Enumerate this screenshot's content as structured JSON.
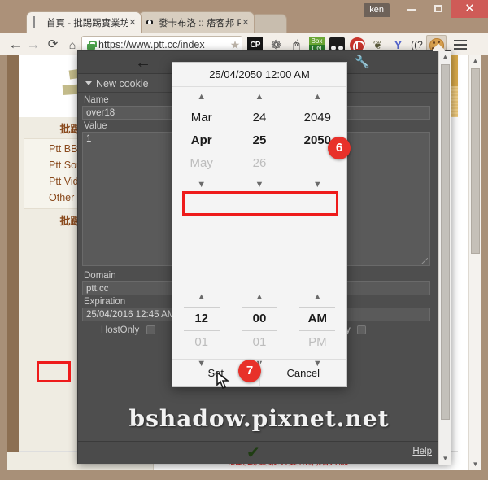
{
  "window": {
    "profile_label": "ken",
    "minimize_label": "–",
    "maximize_label": "□",
    "close_label": "✕"
  },
  "tabs": [
    {
      "title": "首頁 - 批踢踢實業坊",
      "close_label": "✕",
      "favicon": "document-icon",
      "active": true
    },
    {
      "title": "發卡布洛 :: 痞客邦 PIXNET",
      "close_label": "✕",
      "favicon": "pixnet-icon",
      "active": false
    }
  ],
  "toolbar": {
    "back_icon": "←",
    "forward_icon": "→",
    "reload_icon": "⟳",
    "home_icon": "⌂",
    "url": "https://www.ptt.cc/index",
    "star_icon": "★",
    "lock_icon": "lock-icon",
    "extensions": [
      {
        "name": "cp-extension-icon",
        "label": "CP"
      },
      {
        "name": "bee-extension-icon",
        "label": "❁"
      },
      {
        "name": "mouse-extension-icon",
        "label": "🖱"
      },
      {
        "name": "boxon-extension-icon",
        "label_top": "Box",
        "label_bottom": "ON"
      },
      {
        "name": "dots-extension-icon",
        "label": ""
      },
      {
        "name": "adblock-extension-icon",
        "label": ""
      },
      {
        "name": "evernote-extension-icon",
        "label": "❦"
      },
      {
        "name": "yahoo-extension-icon",
        "label": "Y"
      },
      {
        "name": "wifi-extension-icon",
        "label": "((?"
      },
      {
        "name": "cookie-extension-icon",
        "label": ""
      }
    ],
    "menu_icon": "hamburger-menu-icon"
  },
  "page": {
    "logo_text": "批踢",
    "sidebar_sections": [
      {
        "heading": "批踢踢服務",
        "items": [
          "Ptt BBS",
          "Ptt Source",
          "Ptt Video",
          "Other Services"
        ]
      },
      {
        "heading": "批踢踢新聞",
        "items": []
      }
    ],
    "footer_notice": "批踢踢實業坊支持網站分級"
  },
  "popup": {
    "back_arrow_icon": "←",
    "wrench_icon": "🔧",
    "section_label": "New cookie",
    "fields": [
      {
        "label": "Name",
        "value": "over18"
      },
      {
        "label": "Value",
        "value": "1"
      },
      {
        "label": "Domain",
        "value": "ptt.cc"
      },
      {
        "label": "Expiration",
        "value": "25/04/2016 12:45 AM"
      }
    ],
    "checkboxes": [
      {
        "label": "HostOnly",
        "checked": false
      },
      {
        "label": "HttpOnly",
        "checked": false
      }
    ],
    "watermark": "bshadow.pixnet.net",
    "confirm_icon": "✔",
    "help_label": "Help",
    "scroll_up_icon": "▲",
    "scroll_down_icon": "▼"
  },
  "picker": {
    "title": "25/04/2050 12:00 AM",
    "up_arrow": "▲",
    "down_arrow": "▼",
    "date_columns": [
      {
        "name": "month",
        "prev": "Mar",
        "selected": "Apr",
        "next": "May"
      },
      {
        "name": "day",
        "prev": "24",
        "selected": "25",
        "next": "26"
      },
      {
        "name": "year",
        "prev": "2049",
        "selected": "2050",
        "next": ""
      }
    ],
    "time_columns": [
      {
        "name": "hour",
        "selected": "12",
        "next": "01"
      },
      {
        "name": "minute",
        "selected": "00",
        "next": "01"
      },
      {
        "name": "meridiem",
        "selected": "AM",
        "next": "PM"
      }
    ],
    "set_label": "Set",
    "cancel_label": "Cancel",
    "badges": [
      {
        "number": "6",
        "target": "date-row"
      },
      {
        "number": "7",
        "target": "set-button"
      }
    ],
    "highlight_color": "#ee1b1b",
    "badge_color": "#e8312a"
  }
}
